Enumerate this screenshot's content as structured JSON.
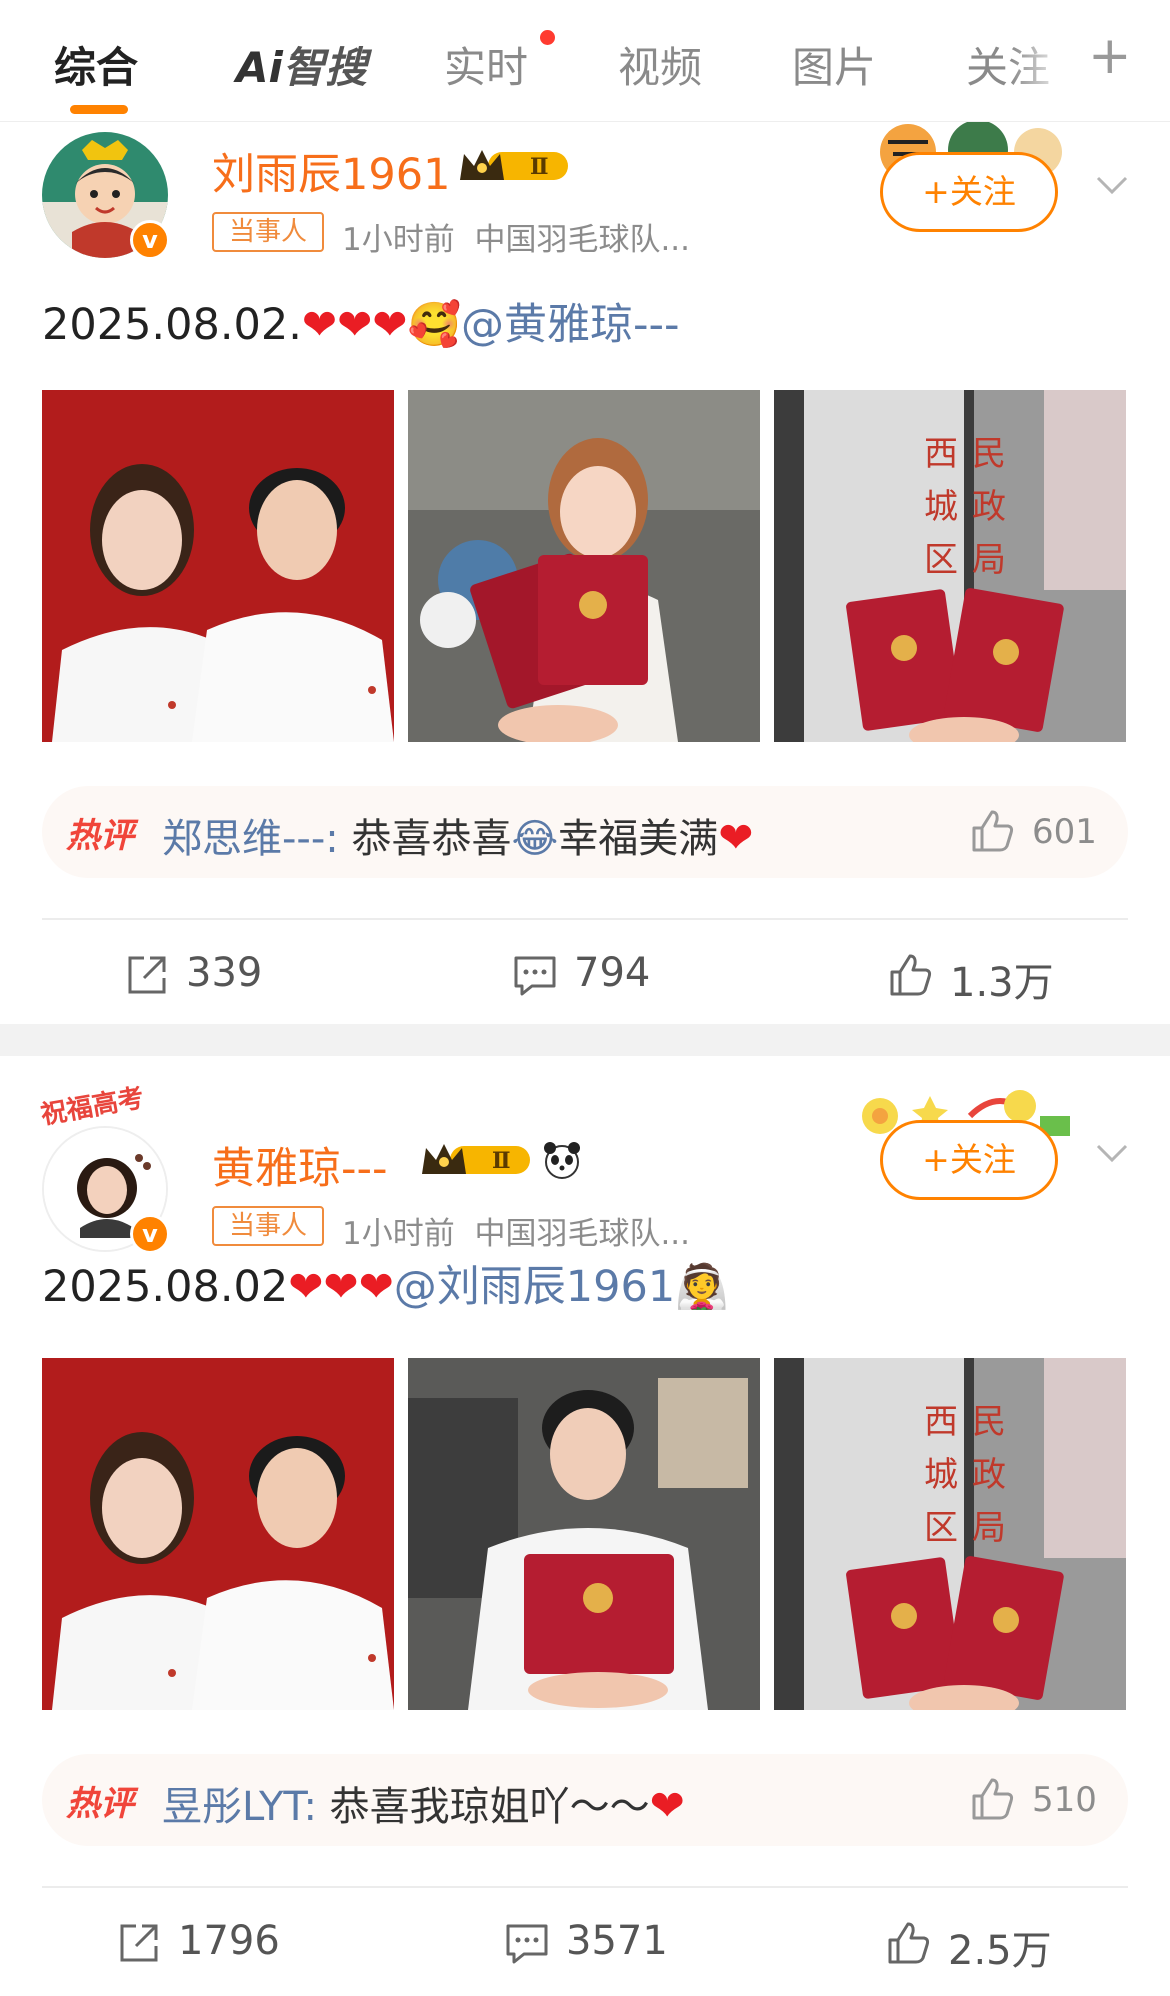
{
  "tabs": {
    "items": [
      {
        "label": "综合",
        "active": true
      },
      {
        "label": "AI智搜",
        "ai_prefix": "Ai",
        "ai_suffix": "智搜"
      },
      {
        "label": "实时",
        "has_dot": true
      },
      {
        "label": "视频"
      },
      {
        "label": "图片"
      },
      {
        "label": "关注"
      }
    ],
    "add_icon": "plus-icon"
  },
  "colors": {
    "accent": "#ff8200",
    "username": "#f76e1a",
    "mention": "#5b7aa8",
    "heart": "#ea1d24"
  },
  "posts": [
    {
      "username": "刘雨辰1961",
      "vip_level": "Ⅱ",
      "role_tag": "当事人",
      "time": "1小时前",
      "org": "中国羽毛球队...",
      "follow_label": "+关注",
      "text_prefix": "2025.08.02.",
      "mention": "@黄雅琼---",
      "emoji_after": "🥰",
      "photos": [
        "couple-portrait",
        "bride-holding-certificate",
        "certificates-at-registry"
      ],
      "registry_sign": [
        "西",
        "民",
        "城",
        "政",
        "区",
        "局"
      ],
      "hot_comment": {
        "tag": "热评",
        "user": "郑思维---:",
        "text": " 恭喜恭喜",
        "emoji": "😂",
        "text2": "幸福美满",
        "likes": "601"
      },
      "reposts": "339",
      "comments": "794",
      "likes": "1.3万"
    },
    {
      "username": "黄雅琼---",
      "vip_level": "Ⅱ",
      "role_tag": "当事人",
      "time": "1小时前",
      "org": "中国羽毛球队...",
      "follow_label": "+关注",
      "avatar_pendant": "祝福高考",
      "text_prefix": "2025.08.02",
      "mention": "@刘雨辰1961",
      "emoji_after": "👰",
      "photos": [
        "couple-portrait",
        "groom-holding-certificate",
        "certificates-at-registry"
      ],
      "registry_sign": [
        "西",
        "民",
        "城",
        "政",
        "区",
        "局"
      ],
      "hot_comment": {
        "tag": "热评",
        "user": "昱彤LYT:",
        "text": " 恭喜我琼姐吖～～",
        "likes": "510"
      },
      "reposts": "1796",
      "comments": "3571",
      "likes": "2.5万"
    }
  ]
}
